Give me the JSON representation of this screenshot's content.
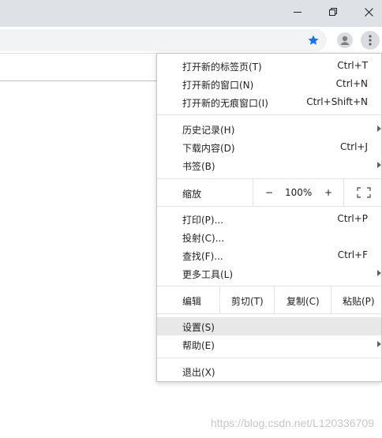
{
  "colors": {
    "accent": "#1a73e8",
    "titlebar": "#dee1e6",
    "omnibox": "#f1f3f4",
    "hover": "#e8e8e8"
  },
  "window": {
    "minimize_icon": "minimize-icon",
    "restore_icon": "restore-icon",
    "close_icon": "close-icon"
  },
  "toolbar": {
    "star_icon": "star-icon",
    "profile_icon": "profile-icon",
    "menu_icon": "more-vert-icon"
  },
  "menu": {
    "group1": [
      {
        "label": "打开新的标签页(T)",
        "shortcut": "Ctrl+T"
      },
      {
        "label": "打开新的窗口(N)",
        "shortcut": "Ctrl+N"
      },
      {
        "label": "打开新的无痕窗口(I)",
        "shortcut": "Ctrl+Shift+N"
      }
    ],
    "group2": [
      {
        "label": "历史记录(H)",
        "shortcut": ""
      },
      {
        "label": "下载内容(D)",
        "shortcut": "Ctrl+J"
      },
      {
        "label": "书签(B)",
        "shortcut": ""
      }
    ],
    "zoom": {
      "label": "缩放",
      "minus": "−",
      "value": "100%",
      "plus": "+"
    },
    "group3": [
      {
        "label": "打印(P)...",
        "shortcut": "Ctrl+P"
      },
      {
        "label": "投射(C)...",
        "shortcut": ""
      },
      {
        "label": "查找(F)...",
        "shortcut": "Ctrl+F"
      },
      {
        "label": "更多工具(L)",
        "shortcut": ""
      }
    ],
    "edit": {
      "label": "编辑",
      "cut": "剪切(T)",
      "copy": "复制(C)",
      "paste": "粘贴(P)"
    },
    "group4": [
      {
        "label": "设置(S)"
      },
      {
        "label": "帮助(E)"
      }
    ],
    "exit": {
      "label": "退出(X)"
    }
  },
  "watermark": "https://blog.csdn.net/L120336709"
}
